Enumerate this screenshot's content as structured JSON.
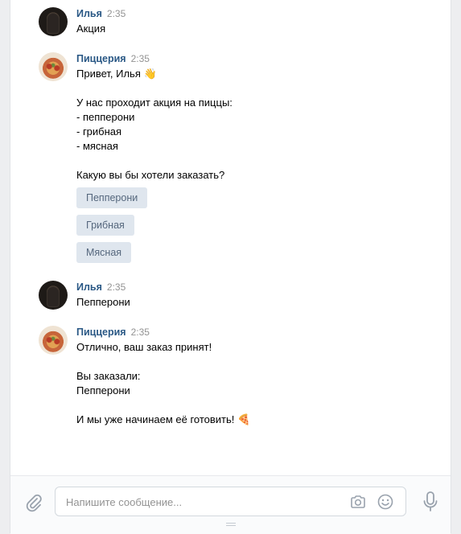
{
  "messages": [
    {
      "author": "Илья",
      "time": "2:35",
      "avatar": "ilya-avatar",
      "text": "Акция",
      "buttons": []
    },
    {
      "author": "Пиццерия",
      "time": "2:35",
      "avatar": "pizzeria-avatar",
      "text": "Привет, Илья 👋\n\nУ нас проходит акция на пиццы:\n- пепперони\n- грибная\n- мясная\n\nКакую вы бы хотели заказать?",
      "buttons": [
        "Пепперони",
        "Грибная",
        "Мясная"
      ]
    },
    {
      "author": "Илья",
      "time": "2:35",
      "avatar": "ilya-avatar",
      "text": "Пепперони",
      "buttons": []
    },
    {
      "author": "Пиццерия",
      "time": "2:35",
      "avatar": "pizzeria-avatar",
      "text": "Отлично, ваш заказ принят!\n\nВы заказали:\nПепперони\n\nИ мы уже начинаем её готовить! 🍕",
      "buttons": []
    }
  ],
  "composer": {
    "placeholder": "Напишите сообщение...",
    "icons": [
      "paperclip-icon",
      "camera-icon",
      "smile-icon",
      "microphone-icon"
    ]
  },
  "colors": {
    "author": "#2a5885",
    "time": "#939393",
    "button_bg": "#dfe6ee",
    "button_text": "#55677d",
    "page_bg": "#edeef0"
  }
}
